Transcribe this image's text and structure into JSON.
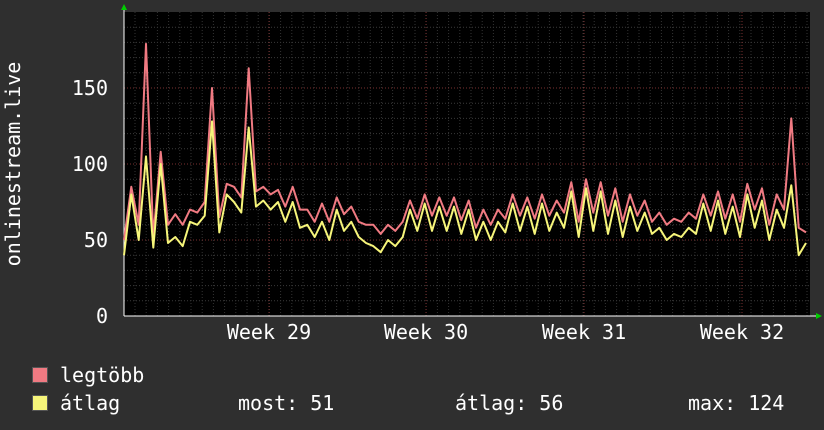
{
  "chart_data": {
    "type": "line",
    "ylabel": "onlinestream.live",
    "ylim": [
      0,
      200
    ],
    "yticks": [
      0,
      50,
      100,
      150
    ],
    "xticks": [
      "Week 29",
      "Week 30",
      "Week 31",
      "Week 32"
    ],
    "grid": true,
    "background": "#000000",
    "series": [
      {
        "name": "legtöbb",
        "color": "#f07a82",
        "values": [
          50,
          85,
          60,
          179,
          52,
          108,
          60,
          67,
          60,
          70,
          68,
          75,
          150,
          65,
          87,
          85,
          78,
          163,
          82,
          85,
          80,
          83,
          72,
          85,
          70,
          70,
          62,
          74,
          62,
          78,
          67,
          72,
          62,
          60,
          60,
          54,
          60,
          56,
          62,
          76,
          64,
          80,
          66,
          78,
          66,
          78,
          63,
          76,
          58,
          70,
          60,
          70,
          64,
          80,
          66,
          78,
          64,
          80,
          66,
          76,
          68,
          88,
          62,
          90,
          68,
          88,
          66,
          84,
          62,
          80,
          66,
          76,
          62,
          68,
          60,
          64,
          62,
          68,
          64,
          80,
          66,
          82,
          64,
          80,
          62,
          87,
          70,
          84,
          60,
          80,
          70,
          130,
          58,
          55
        ]
      },
      {
        "name": "átlag",
        "color": "#f6f57a",
        "values": [
          40,
          80,
          50,
          105,
          45,
          100,
          48,
          52,
          46,
          62,
          60,
          66,
          128,
          55,
          80,
          75,
          68,
          124,
          72,
          76,
          70,
          75,
          62,
          75,
          58,
          60,
          52,
          62,
          50,
          70,
          56,
          62,
          52,
          48,
          46,
          42,
          50,
          46,
          52,
          70,
          56,
          74,
          56,
          72,
          56,
          72,
          54,
          70,
          50,
          62,
          50,
          62,
          55,
          74,
          56,
          72,
          54,
          74,
          56,
          68,
          58,
          82,
          52,
          84,
          56,
          82,
          54,
          76,
          52,
          72,
          56,
          68,
          54,
          58,
          50,
          54,
          52,
          58,
          54,
          74,
          56,
          76,
          54,
          72,
          52,
          80,
          58,
          76,
          50,
          70,
          58,
          86,
          40,
          48
        ]
      }
    ]
  },
  "legend": [
    {
      "label": "legtöbb",
      "color": "#f07a82"
    },
    {
      "label": "átlag",
      "color": "#f6f57a"
    }
  ],
  "stats": {
    "most": "most: 51",
    "atlag": "átlag: 56",
    "max": "max: 124"
  }
}
